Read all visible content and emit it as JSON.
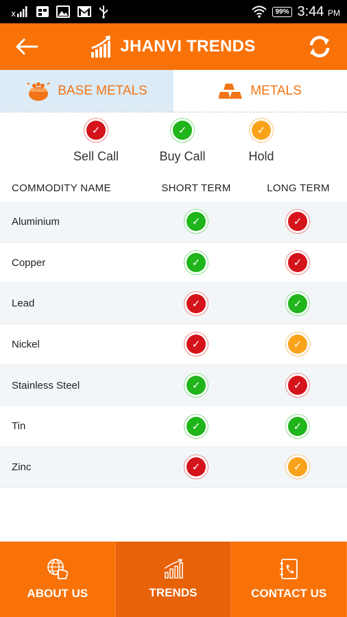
{
  "status_bar": {
    "battery": "99%",
    "time": "3:44",
    "ampm": "PM"
  },
  "app": {
    "title": "JHANVI TRENDS"
  },
  "tabs": [
    {
      "label": "BASE METALS",
      "active": true
    },
    {
      "label": "METALS",
      "active": false
    }
  ],
  "legend": [
    {
      "label": "Sell Call",
      "status": "red"
    },
    {
      "label": "Buy Call",
      "status": "green"
    },
    {
      "label": "Hold",
      "status": "orange"
    }
  ],
  "table": {
    "headers": [
      "COMMODITY NAME",
      "SHORT TERM",
      "LONG TERM"
    ],
    "rows": [
      {
        "name": "Aluminium",
        "short": "green",
        "long": "red"
      },
      {
        "name": "Copper",
        "short": "green",
        "long": "red"
      },
      {
        "name": "Lead",
        "short": "red",
        "long": "green"
      },
      {
        "name": "Nickel",
        "short": "red",
        "long": "orange"
      },
      {
        "name": "Stainless Steel",
        "short": "green",
        "long": "red"
      },
      {
        "name": "Tin",
        "short": "green",
        "long": "green"
      },
      {
        "name": "Zinc",
        "short": "red",
        "long": "orange"
      }
    ]
  },
  "bottom_nav": [
    {
      "label": "ABOUT US",
      "icon": "globe-hand-icon",
      "active": false
    },
    {
      "label": "TRENDS",
      "icon": "trend-chart-icon",
      "active": true
    },
    {
      "label": "CONTACT US",
      "icon": "phone-book-icon",
      "active": false
    }
  ],
  "colors": {
    "brand": "#f97208",
    "sell": "#d5131b",
    "buy": "#1fb51b",
    "hold": "#f9a31b"
  }
}
